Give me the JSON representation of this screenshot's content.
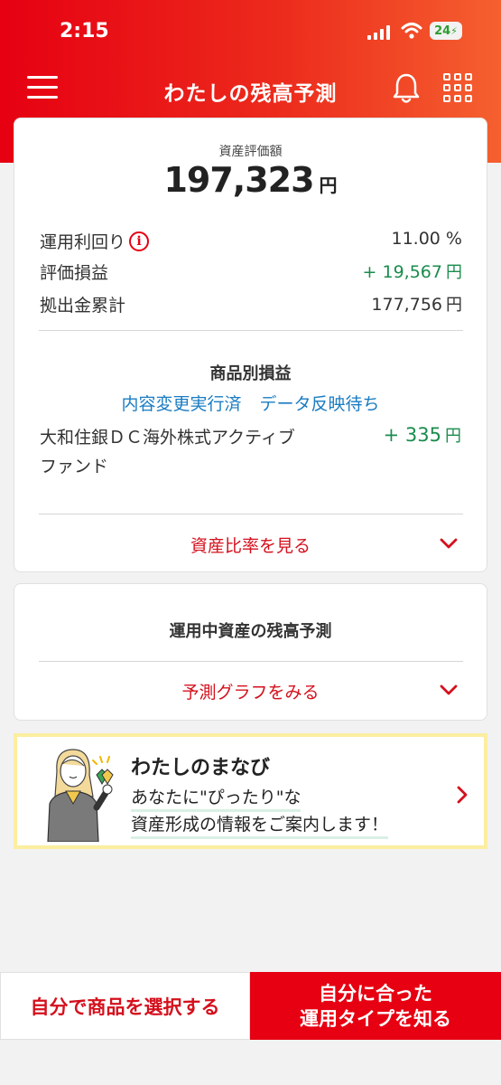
{
  "status_bar": {
    "time": "2:15",
    "battery": "24"
  },
  "app_bar": {
    "title": "わたしの残高予測"
  },
  "summary": {
    "label": "資産評価額",
    "amount": "197,323",
    "unit": "円",
    "rows": [
      {
        "label": "運用利回り",
        "value": "11.00 %",
        "unit": ""
      },
      {
        "label": "評価損益",
        "value": "+ 19,567",
        "unit": "円"
      },
      {
        "label": "拠出金累計",
        "value": "177,756",
        "unit": "円"
      }
    ]
  },
  "product_pl": {
    "title": "商品別損益",
    "link_executed": "内容変更実行済",
    "link_pending": "データ反映待ち",
    "fund_name": "大和住銀ＤＣ海外株式アクティブファンド",
    "fund_value": "+ 335",
    "fund_unit": "円",
    "expander_label": "資産比率を見る"
  },
  "forecast": {
    "title": "運用中資産の残高予測",
    "expander_label": "予測グラフをみる"
  },
  "banner": {
    "title": "わたしのまなび",
    "line1": "あなたに\"ぴったり\"な",
    "line2": "資産形成の情報をご案内します！"
  },
  "footer": {
    "select_button": "自分で商品を選択する",
    "type_button_line1": "自分に合った",
    "type_button_line2": "運用タイプを知る"
  },
  "colors": {
    "brand_red": "#e60012",
    "link_blue": "#1a7cc2",
    "gain_green": "#1a8c4d",
    "banner_border": "#fbeea0"
  }
}
